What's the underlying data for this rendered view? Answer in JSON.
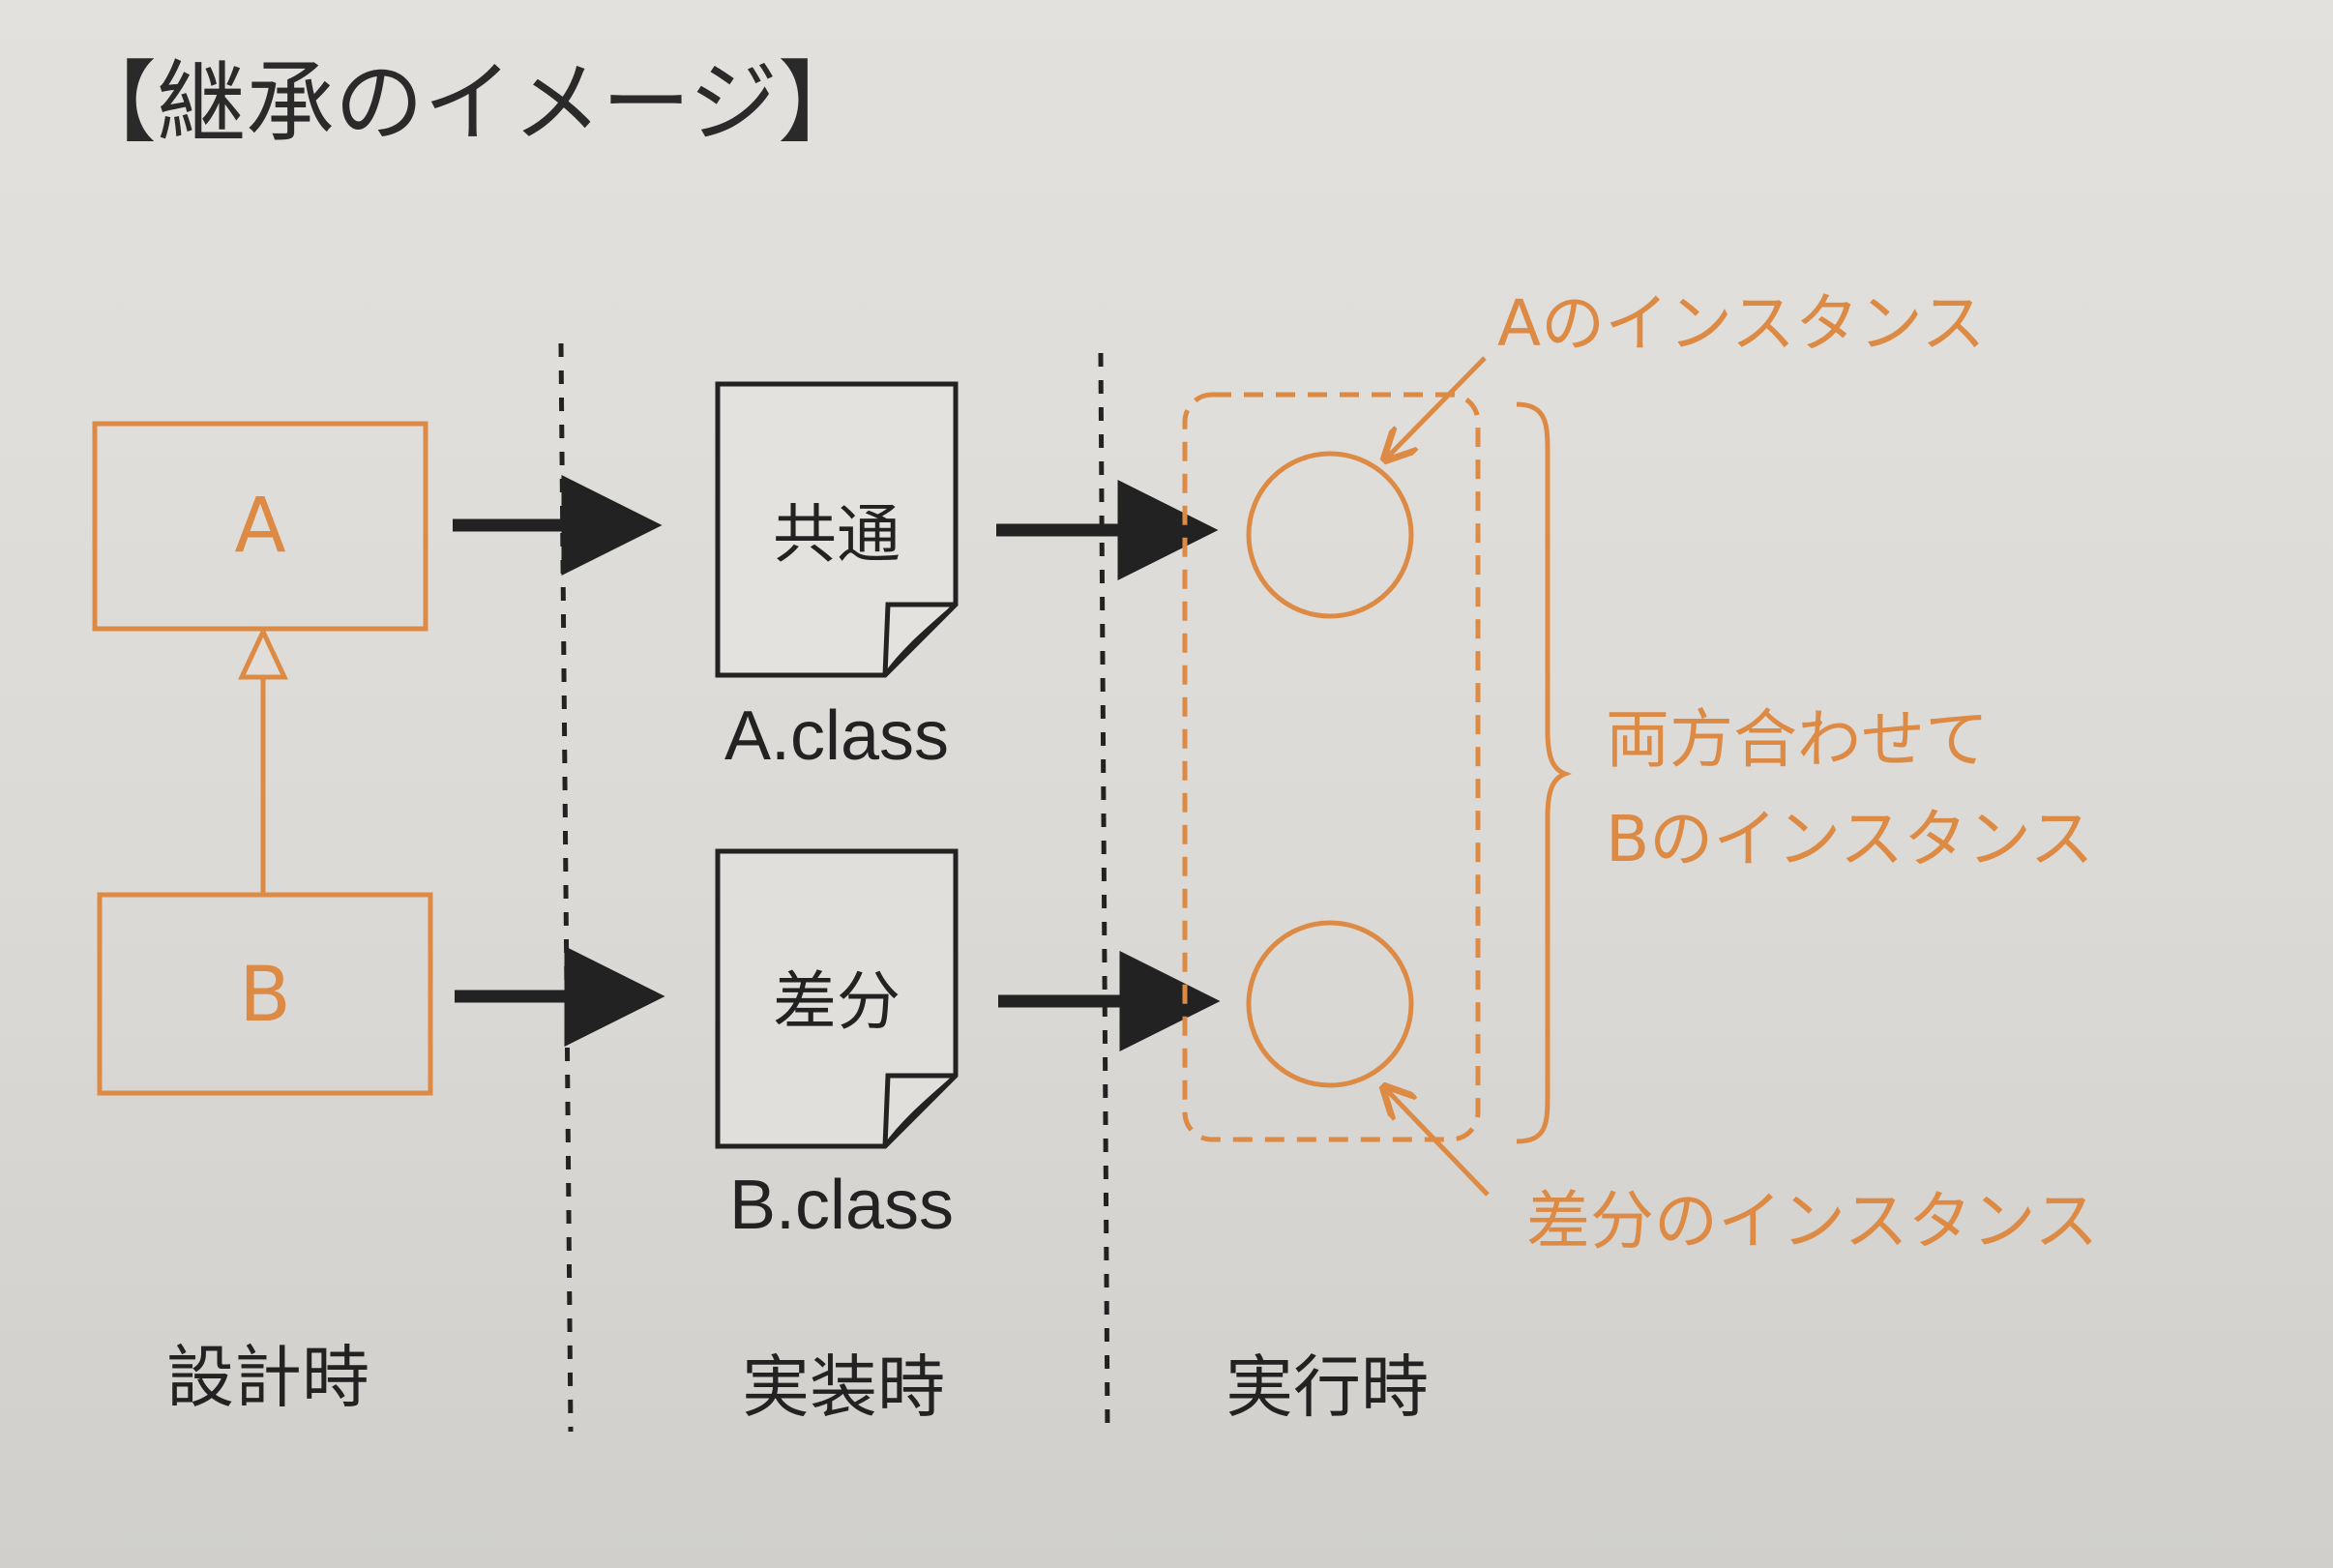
{
  "title": "【継承のイメージ】",
  "classes": [
    {
      "name": "A",
      "file_label": "A.class",
      "doc_label": "共通"
    },
    {
      "name": "B",
      "file_label": "B.class",
      "doc_label": "差分"
    }
  ],
  "phases": [
    "設計時",
    "実装時",
    "実行時"
  ],
  "annotations": {
    "a_instance": "Aのインスタンス",
    "diff_instance": "差分のインスタンス",
    "b_instance_line1": "両方合わせて",
    "b_instance_line2": "Bのインスタンス"
  },
  "colors": {
    "accent": "#dd8a45",
    "ink": "#222222"
  }
}
